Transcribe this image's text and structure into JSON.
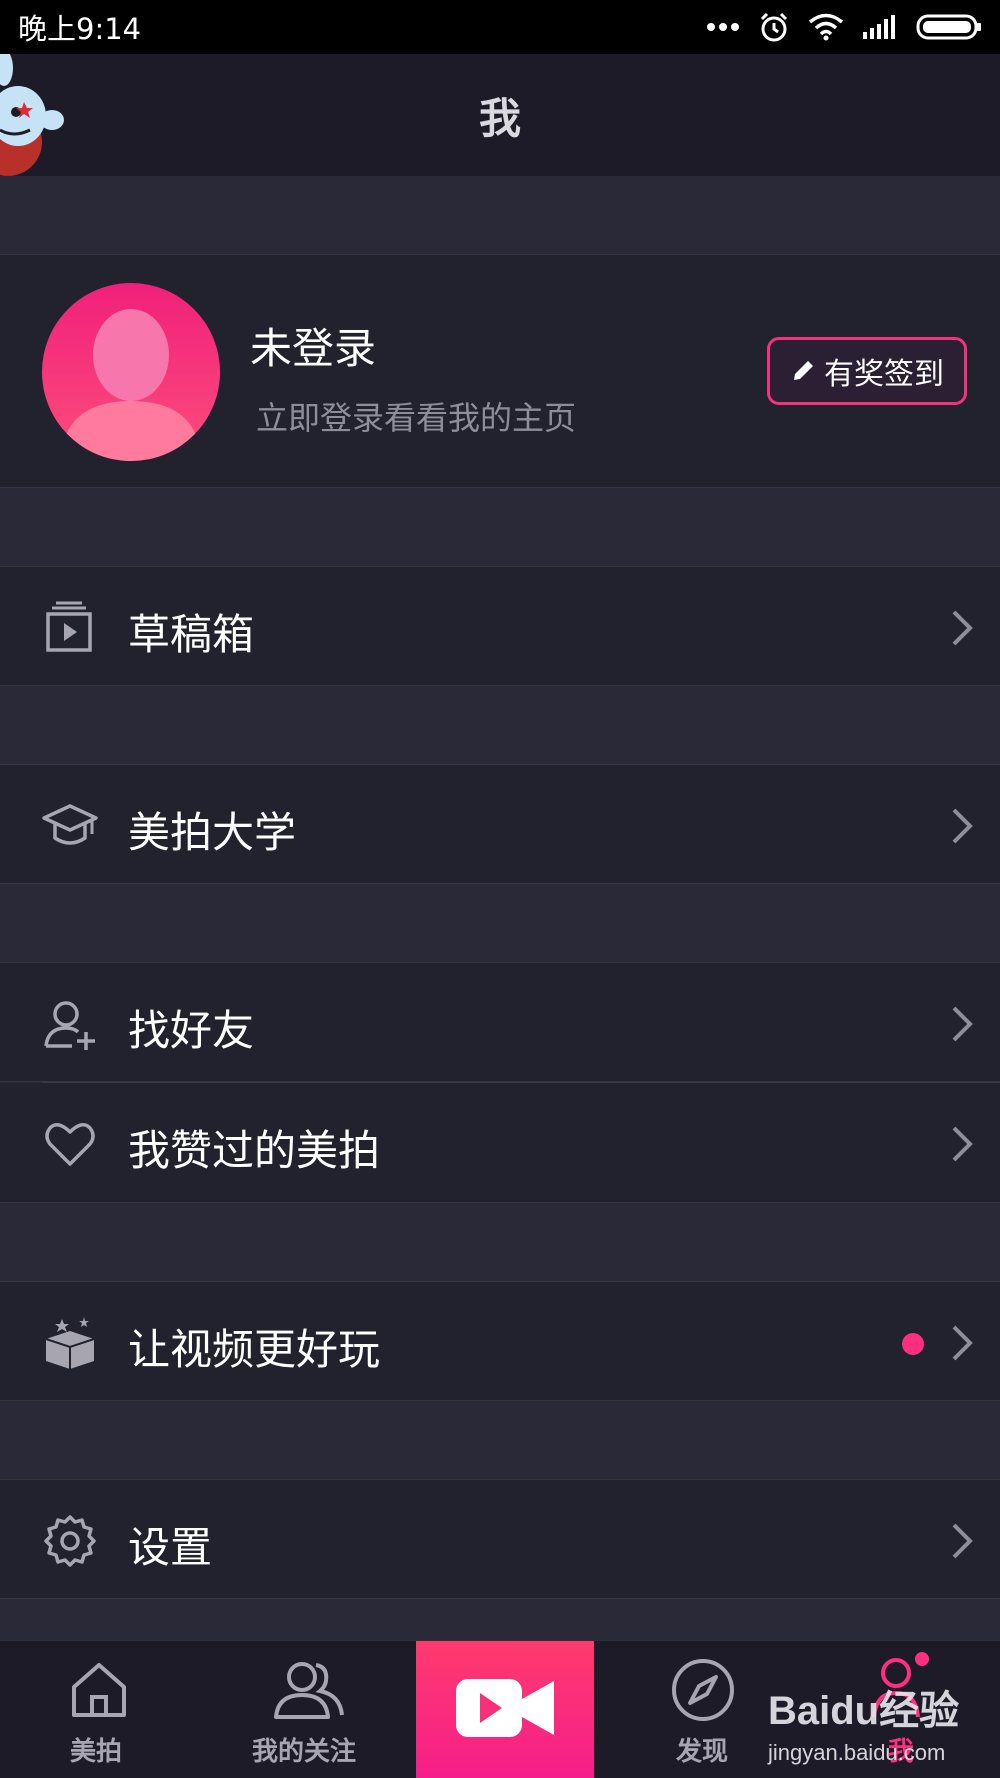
{
  "status_bar": {
    "time": "晚上9:14",
    "icons": [
      "more-dots-icon",
      "alarm-icon",
      "wifi-icon",
      "signal-icon",
      "battery-icon"
    ]
  },
  "header": {
    "title": "我"
  },
  "profile": {
    "name": "未登录",
    "subtitle": "立即登录看看我的主页",
    "checkin_label": "有奖签到"
  },
  "menu": {
    "drafts": {
      "label": "草稿箱",
      "icon": "drafts-icon"
    },
    "university": {
      "label": "美拍大学",
      "icon": "graduation-cap-icon"
    },
    "find_friends": {
      "label": "找好友",
      "icon": "add-user-icon"
    },
    "liked": {
      "label": "我赞过的美拍",
      "icon": "heart-icon"
    },
    "fun_video": {
      "label": "让视频更好玩",
      "icon": "magic-box-icon",
      "has_new": true
    },
    "settings": {
      "label": "设置",
      "icon": "gear-icon"
    }
  },
  "tab_bar": {
    "tabs": [
      {
        "label": "美拍",
        "icon": "home-icon"
      },
      {
        "label": "我的关注",
        "icon": "users-icon"
      },
      {
        "label": "",
        "icon": "video-camera-icon"
      },
      {
        "label": "发现",
        "icon": "compass-icon"
      },
      {
        "label": "我",
        "icon": "user-icon",
        "active": true
      }
    ]
  },
  "watermark": {
    "brand": "Baidu经验",
    "url": "jingyan.baidu.com"
  },
  "colors": {
    "accent": "#ff2e7e",
    "background": "#2a2937",
    "row": "#22212e",
    "header": "#1c1b27"
  }
}
